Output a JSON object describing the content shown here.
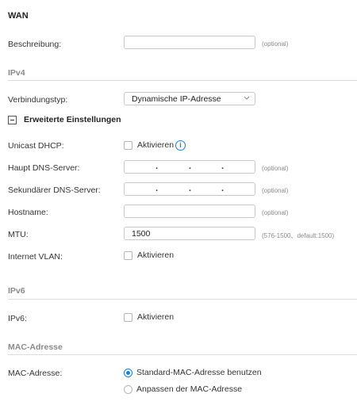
{
  "title": "WAN",
  "description": {
    "label": "Beschreibung:",
    "value": "",
    "hint": "(optional)"
  },
  "ipv4": {
    "section": "IPv4",
    "connection_type": {
      "label": "Verbindungstyp:",
      "value": "Dynamische IP-Adresse"
    },
    "advanced_toggle": "Erweiterte Einstellungen",
    "unicast_dhcp": {
      "label": "Unicast DHCP:",
      "checkbox_label": "Aktivieren",
      "checked": false
    },
    "primary_dns": {
      "label": "Haupt DNS-Server:",
      "hint": "(optional)",
      "dots": [
        ".",
        ".",
        "."
      ]
    },
    "secondary_dns": {
      "label": "Sekundärer DNS-Server:",
      "hint": "(optional)",
      "dots": [
        ".",
        ".",
        "."
      ]
    },
    "hostname": {
      "label": "Hostname:",
      "value": "",
      "hint": "(optional)"
    },
    "mtu": {
      "label": "MTU:",
      "value": "1500",
      "hint": "(576-1500、default:1500)"
    },
    "internet_vlan": {
      "label": "Internet VLAN:",
      "checkbox_label": "Aktivieren",
      "checked": false
    }
  },
  "ipv6": {
    "section": "IPv6",
    "field": {
      "label": "IPv6:",
      "checkbox_label": "Aktivieren",
      "checked": false
    }
  },
  "mac": {
    "section": "MAC-Adresse",
    "label": "MAC-Adresse:",
    "options": [
      {
        "label": "Standard-MAC-Adresse benutzen",
        "selected": true
      },
      {
        "label": "Anpassen der MAC-Adresse",
        "selected": false
      }
    ]
  },
  "colors": {
    "accent": "#1a7fd8",
    "border": "#c9c9c9",
    "section": "#8a8a8a"
  }
}
